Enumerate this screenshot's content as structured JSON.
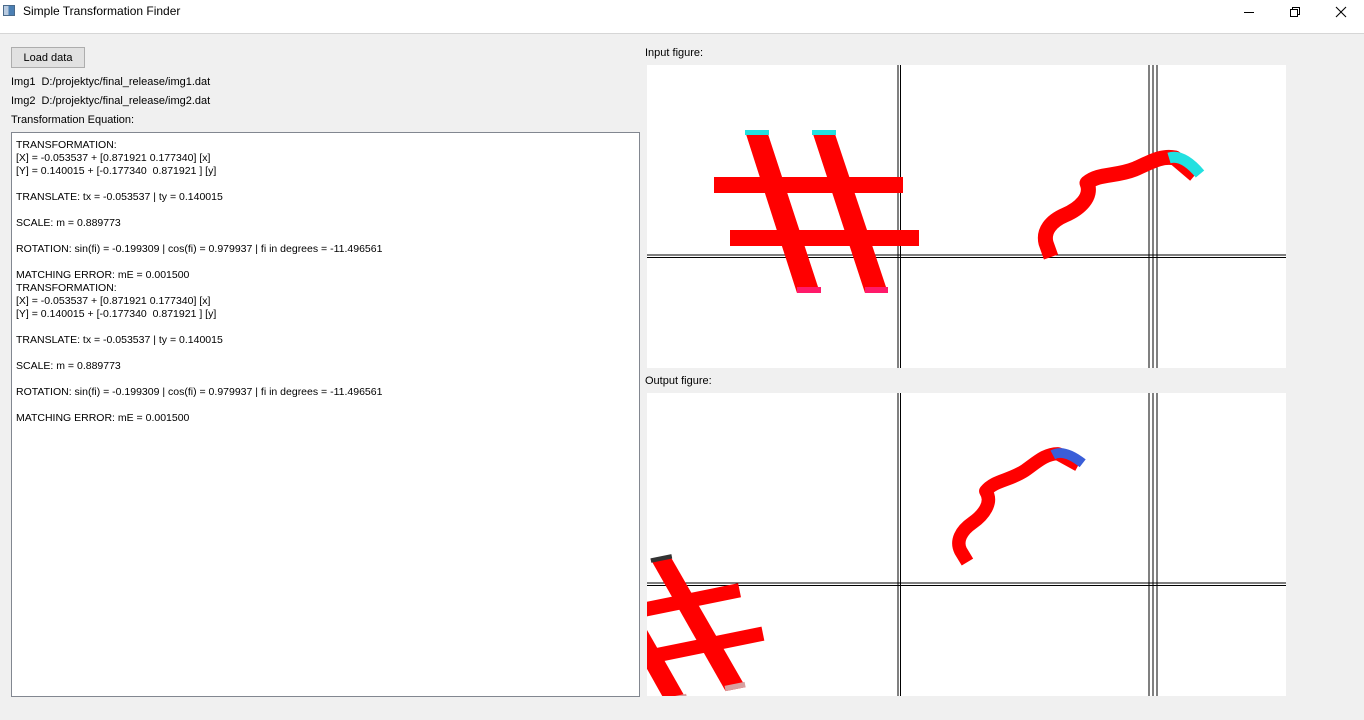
{
  "window": {
    "title": "Simple Transformation Finder",
    "icons": [
      "app-icon",
      "minimize-icon",
      "restore-icon",
      "close-icon"
    ]
  },
  "toolbar": {
    "load_label": "Load data"
  },
  "files": {
    "img1_label": "Img1",
    "img1_path": "D:/projektyc/final_release/img1.dat",
    "img2_label": "Img2",
    "img2_path": "D:/projektyc/final_release/img2.dat"
  },
  "equation": {
    "label": "Transformation Equation:",
    "text": "TRANSFORMATION:\n[X] = -0.053537 + [0.871921 0.177340] [x]\n[Y] = 0.140015 + [-0.177340  0.871921 ] [y]\n\nTRANSLATE: tx = -0.053537 | ty = 0.140015\n\nSCALE: m = 0.889773\n\nROTATION: sin(fi) = -0.199309 | cos(fi) = 0.979937 | fi in degrees = -11.496561\n\nMATCHING ERROR: mE = 0.001500\nTRANSFORMATION:\n[X] = -0.053537 + [0.871921 0.177340] [x]\n[Y] = 0.140015 + [-0.177340  0.871921 ] [y]\n\nTRANSLATE: tx = -0.053537 | ty = 0.140015\n\nSCALE: m = 0.889773\n\nROTATION: sin(fi) = -0.199309 | cos(fi) = 0.979937 | fi in degrees = -11.496561\n\nMATCHING ERROR: mE = 0.001500"
  },
  "figures": {
    "input_label": "Input figure:",
    "output_label": "Output figure:",
    "shape_color": "#ff0000",
    "input_highlight_color": "#22e0e0",
    "input_tip_color": "#ff1a6a",
    "output_highlight_color": "#3a5ed8",
    "output_tip_color": "#d8a0a0",
    "axis_color": "#000000",
    "shapes": [
      "hash-shape",
      "brace-shape"
    ]
  },
  "colors": {
    "window_bg": "#f0f0f0",
    "panel_bg": "#ffffff"
  }
}
